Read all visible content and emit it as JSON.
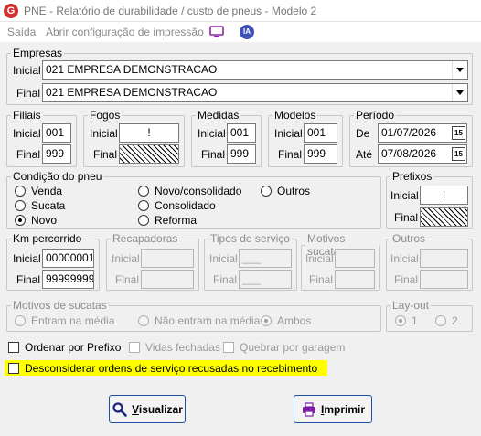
{
  "window": {
    "title": "PNE - Relatório de durabilidade / custo de pneus -  Modelo 2"
  },
  "menu": {
    "exit": "Saída",
    "print_config": "Abrir configuração de impressão",
    "ia_label": "IA"
  },
  "empresas": {
    "legend": "Empresas",
    "inicial_label": "Inicial",
    "final_label": "Final",
    "inicial_value": "021 EMPRESA DEMONSTRACAO",
    "final_value": "021 EMPRESA DEMONSTRACAO"
  },
  "filiais": {
    "legend": "Filiais",
    "inicial_label": "Inicial",
    "final_label": "Final",
    "inicial_value": "001",
    "final_value": "999"
  },
  "fogos": {
    "legend": "Fogos",
    "inicial_label": "Inicial",
    "final_label": "Final",
    "inicial_value": "!"
  },
  "medidas": {
    "legend": "Medidas",
    "inicial_label": "Inicial",
    "final_label": "Final",
    "inicial_value": "001",
    "final_value": "999"
  },
  "modelos": {
    "legend": "Modelos",
    "inicial_label": "Inicial",
    "final_label": "Final",
    "inicial_value": "001",
    "final_value": "999"
  },
  "periodo": {
    "legend": "Período",
    "de_label": "De",
    "ate_label": "Até",
    "de_value": "01/07/2026",
    "ate_value": "07/08/2026",
    "cal_label": "15"
  },
  "condicao": {
    "legend": "Condição do pneu",
    "options": [
      "Venda",
      "Novo/consolidado",
      "Outros",
      "Sucata",
      "Consolidado",
      "Novo",
      "Reforma"
    ],
    "selected": "Novo"
  },
  "prefixos": {
    "legend": "Prefixos",
    "inicial_label": "Inicial",
    "final_label": "Final",
    "inicial_value": "!"
  },
  "km": {
    "legend": "Km percorrido",
    "inicial_label": "Inicial",
    "final_label": "Final",
    "inicial_value": "00000001",
    "final_value": "99999999"
  },
  "recapadoras": {
    "legend": "Recapadoras",
    "inicial_label": "Inicial",
    "final_label": "Final"
  },
  "tipos_servico": {
    "legend": "Tipos de serviço",
    "inicial_label": "Inicial",
    "final_label": "Final",
    "inicial_value": "___",
    "final_value": "___"
  },
  "motivos_sucata": {
    "legend": "Motivos sucata",
    "inicial_label": "Inicial",
    "final_label": "Final"
  },
  "outros": {
    "legend": "Outros",
    "inicial_label": "Inicial",
    "final_label": "Final"
  },
  "motivos_sucatas": {
    "legend": "Motivos de sucatas",
    "options": [
      "Entram na média",
      "Não entram na média",
      "Ambos"
    ],
    "selected": "Ambos"
  },
  "layout": {
    "legend": "Lay-out",
    "options": [
      "1",
      "2"
    ],
    "selected": "1"
  },
  "options": {
    "ordenar_prefixo": "Ordenar por Prefixo",
    "vidas_fechadas": "Vidas fechadas",
    "quebrar_garagem": "Quebrar por garagem",
    "desconsiderar": "Desconsiderar ordens de serviço recusadas no recebimento"
  },
  "buttons": {
    "visualizar_first": "V",
    "visualizar_rest": "isualizar",
    "imprimir_first": "I",
    "imprimir_rest": "mprimir"
  }
}
